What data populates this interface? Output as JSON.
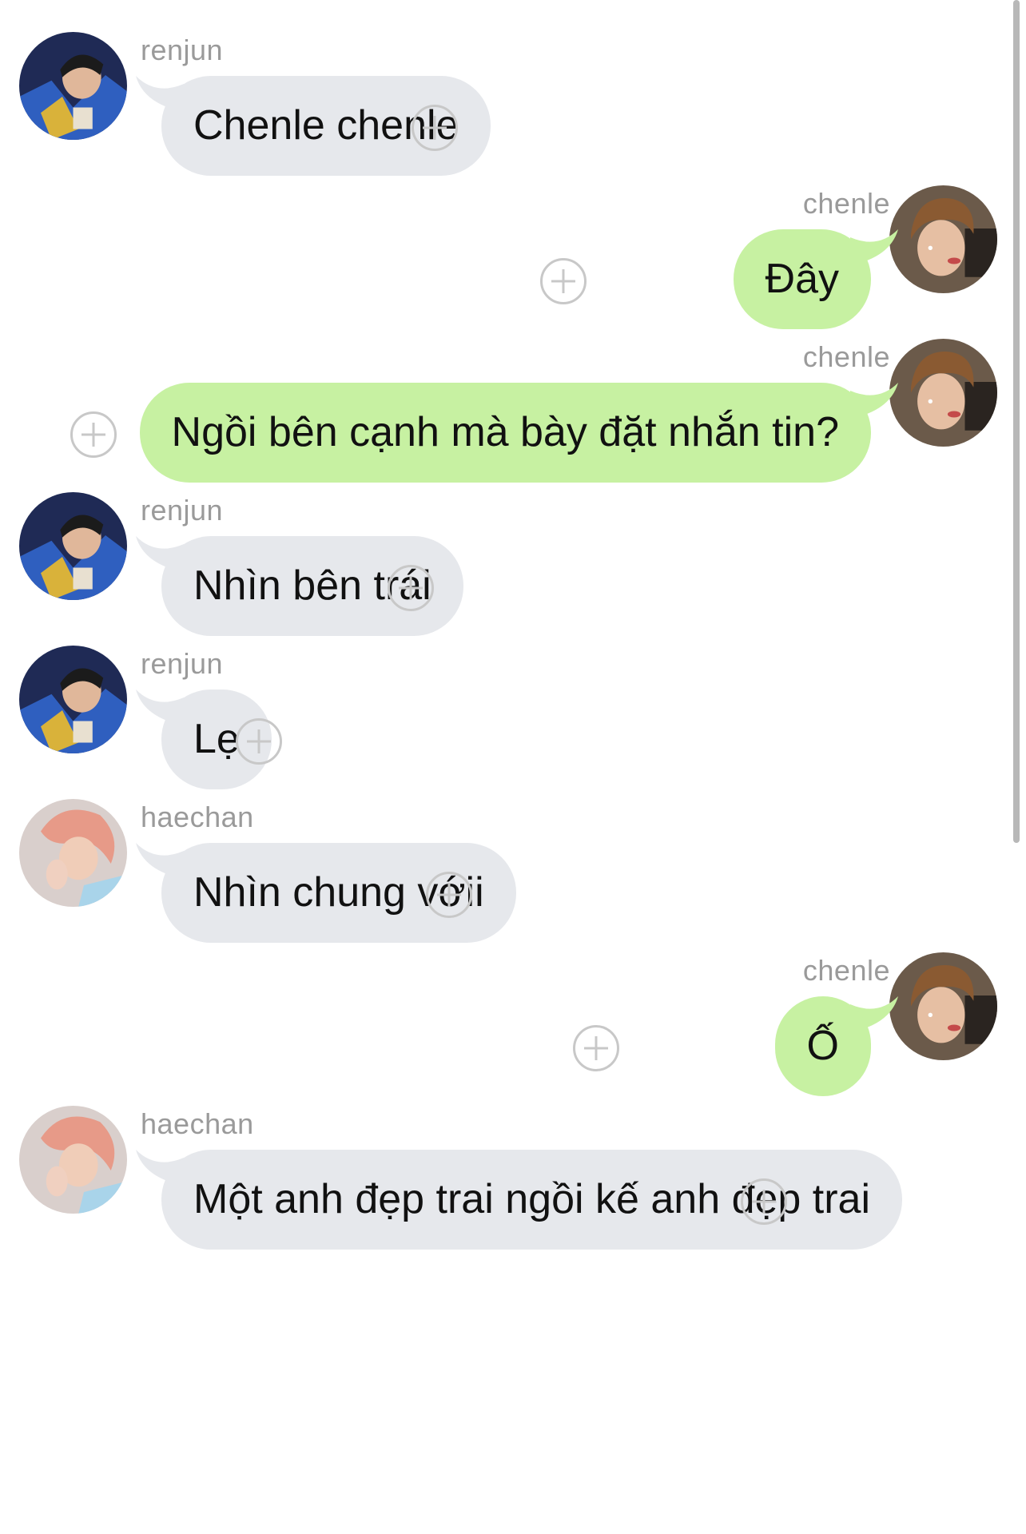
{
  "messages": [
    {
      "sender": "renjun",
      "side": "left",
      "text": "Chenle chenle"
    },
    {
      "sender": "chenle",
      "side": "right",
      "text": "Đây"
    },
    {
      "sender": "chenle",
      "side": "right",
      "text": "Ngồi bên cạnh mà bày đặt nhắn tin?"
    },
    {
      "sender": "renjun",
      "side": "left",
      "text": "Nhìn bên trái"
    },
    {
      "sender": "renjun",
      "side": "left",
      "text": "Lẹ"
    },
    {
      "sender": "haechan",
      "side": "left",
      "text": "Nhìn chung vớii"
    },
    {
      "sender": "chenle",
      "side": "right",
      "text": "Ố"
    },
    {
      "sender": "haechan",
      "side": "left",
      "text": "Một anh đẹp trai ngồi kế anh đẹp trai"
    }
  ],
  "colors": {
    "incoming_bubble": "#e6e8ec",
    "outgoing_bubble": "#c7f1a2",
    "name_text": "#9a9a9a",
    "add_reaction": "#c8c8c8"
  },
  "icons": {
    "add_reaction": "plus-circle-icon"
  }
}
